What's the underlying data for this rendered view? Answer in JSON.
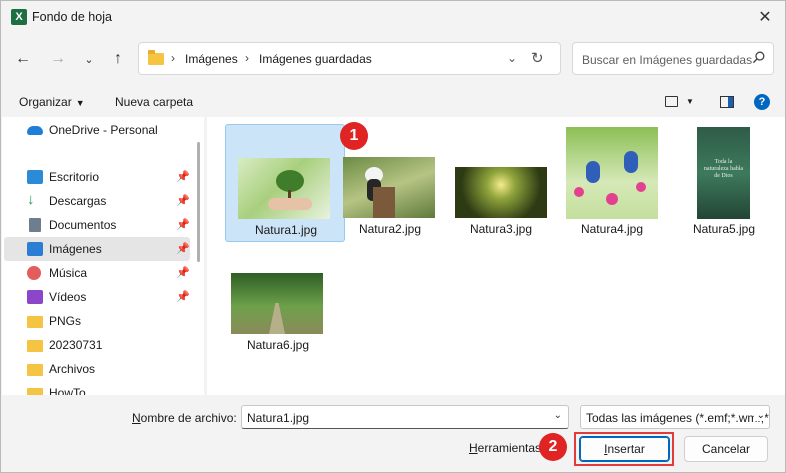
{
  "window": {
    "title": "Fondo de hoja",
    "app_icon": "X"
  },
  "navbar": {
    "breadcrumb": [
      "Imágenes",
      "Imágenes guardadas"
    ],
    "search_placeholder": "Buscar en Imágenes guardadas"
  },
  "toolbar": {
    "organize": "Organizar",
    "new_folder": "Nueva carpeta",
    "help": "?"
  },
  "sidebar": {
    "items": [
      {
        "label": "OneDrive - Personal",
        "icon": "onedrive-icon",
        "pinned": false
      },
      {
        "label": "Escritorio",
        "icon": "desktop-icon",
        "pinned": true
      },
      {
        "label": "Descargas",
        "icon": "downloads-icon",
        "pinned": true
      },
      {
        "label": "Documentos",
        "icon": "documents-icon",
        "pinned": true
      },
      {
        "label": "Imágenes",
        "icon": "pictures-icon",
        "pinned": true,
        "selected": true
      },
      {
        "label": "Música",
        "icon": "music-icon",
        "pinned": true
      },
      {
        "label": "Vídeos",
        "icon": "videos-icon",
        "pinned": true
      },
      {
        "label": "PNGs",
        "icon": "folder-icon",
        "pinned": false
      },
      {
        "label": "20230731",
        "icon": "folder-icon",
        "pinned": false
      },
      {
        "label": "Archivos",
        "icon": "folder-icon",
        "pinned": false
      },
      {
        "label": "HowTo",
        "icon": "folder-icon",
        "pinned": false
      }
    ]
  },
  "files": [
    {
      "name": "Natura1.jpg",
      "selected": true
    },
    {
      "name": "Natura2.jpg"
    },
    {
      "name": "Natura3.jpg"
    },
    {
      "name": "Natura4.jpg"
    },
    {
      "name": "Natura5.jpg",
      "thumb_text": "Toda la naturaleza habla de Dios"
    },
    {
      "name": "Natura6.jpg"
    }
  ],
  "badges": {
    "one": "1",
    "two": "2"
  },
  "footer": {
    "filename_label_u": "N",
    "filename_label_rest": "ombre de archivo:",
    "filename_value": "Natura1.jpg",
    "filter_value": "Todas las imágenes (*.emf;*.wmf;*.jpg",
    "tools_u": "H",
    "tools_rest": "erramientas",
    "insert_u": "I",
    "insert_rest": "nsertar",
    "cancel": "Cancelar"
  },
  "colors": {
    "accent": "#0067c0",
    "badge": "#e02323",
    "selection": "#cce4f7",
    "excel": "#1d6f42"
  }
}
